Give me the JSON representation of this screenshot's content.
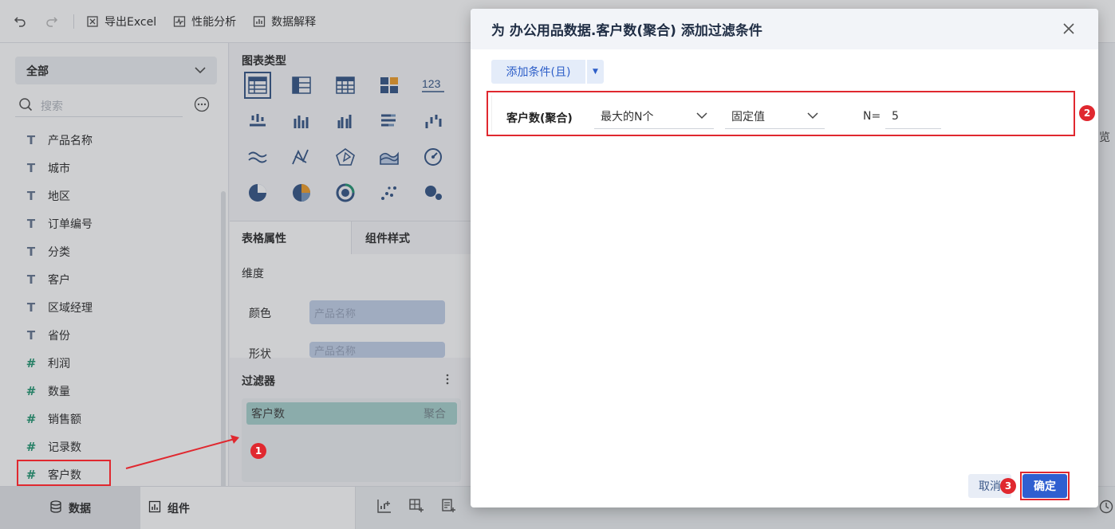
{
  "toolbar": {
    "export_label": "导出Excel",
    "perf_label": "性能分析",
    "explain_label": "数据解释"
  },
  "left": {
    "scope_label": "全部",
    "search_placeholder": "搜索",
    "fields": [
      {
        "type": "T",
        "label": "产品名称"
      },
      {
        "type": "T",
        "label": "城市"
      },
      {
        "type": "T",
        "label": "地区"
      },
      {
        "type": "T",
        "label": "订单编号"
      },
      {
        "type": "T",
        "label": "分类"
      },
      {
        "type": "T",
        "label": "客户"
      },
      {
        "type": "T",
        "label": "区域经理"
      },
      {
        "type": "T",
        "label": "省份"
      },
      {
        "type": "#",
        "label": "利润"
      },
      {
        "type": "#",
        "label": "数量"
      },
      {
        "type": "#",
        "label": "销售额"
      },
      {
        "type": "#",
        "label": "记录数"
      },
      {
        "type": "#",
        "label": "客户数"
      }
    ]
  },
  "mid": {
    "chart_types_title": "图表类型",
    "tab_table": "表格属性",
    "tab_style": "组件样式",
    "dimension_label": "维度",
    "color_label": "颜色",
    "color_value": "产品名称",
    "shape_label": "形状",
    "shape_value": "产品名称",
    "filter_title": "过滤器",
    "filter_chip_name": "客户数",
    "filter_chip_agg": "聚合"
  },
  "bottom": {
    "tab_data": "数据",
    "tab_component": "组件"
  },
  "dialog": {
    "title": "为 办公用品数据.客户数(聚合) 添加过滤条件",
    "add_condition": "添加条件(且)",
    "condition": {
      "field": "客户数(聚合)",
      "operator": "最大的N个",
      "value_type": "固定值",
      "n_label": "N=",
      "n_value": "5"
    },
    "cancel_label": "取消",
    "ok_label": "确定"
  },
  "annotations": {
    "badge1": "1",
    "badge2": "2",
    "badge3": "3"
  },
  "side_peek": "览",
  "colors": {
    "accent": "#2f5fd0",
    "highlight": "#e0282f",
    "chip": "#a9d3cf"
  }
}
